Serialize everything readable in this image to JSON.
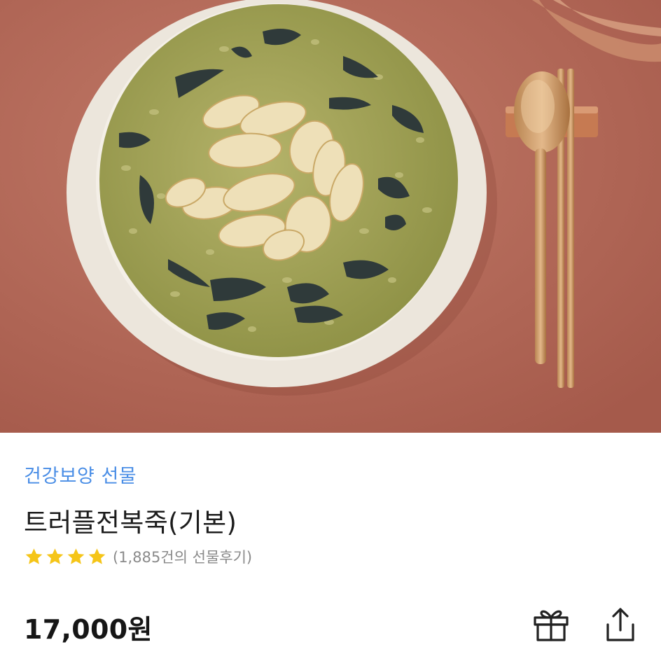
{
  "product": {
    "category": "건강보양 선물",
    "name": "트러플전복죽(기본)",
    "rating_stars": 4,
    "review_count_text": "(1,885건의 선물후기)",
    "price": "17,000원"
  },
  "image": {
    "description_icon": "abalone-porridge-photo"
  },
  "actions": {
    "gift_icon": "gift-icon",
    "share_icon": "share-icon"
  },
  "colors": {
    "category": "#4a8ee6",
    "star": "#f5c518",
    "background_photo": "#b46a5a"
  }
}
